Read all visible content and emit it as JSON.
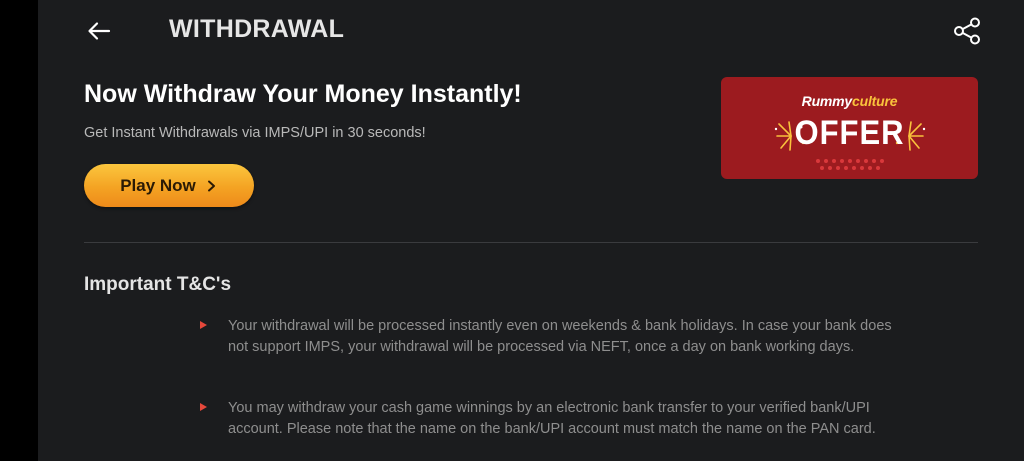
{
  "header": {
    "title": "WITHDRAWAL",
    "back_icon": "arrow-left-icon",
    "share_icon": "share-icon"
  },
  "promo": {
    "title": "Now Withdraw Your Money Instantly!",
    "subtitle": "Get Instant Withdrawals via IMPS/UPI in 30 seconds!",
    "button_label": "Play Now",
    "button_icon": "chevron-right-icon"
  },
  "offer_banner": {
    "brand_part1": "Rummy",
    "brand_part2": "culture",
    "offer_text": "OFFER",
    "background_color": "#9c1b1f",
    "accent_color": "#f9c23c"
  },
  "terms": {
    "heading": "Important T&C's",
    "items": [
      "Your withdrawal will be processed instantly even on weekends & bank holidays. In case your bank does not support IMPS, your withdrawal will be processed via NEFT, once a day on bank working days.",
      "You may withdraw your cash game winnings by an electronic bank transfer to your verified bank/UPI account. Please note that the name on the bank/UPI account must match the name on the PAN card."
    ],
    "bullet_color": "#e5483b"
  },
  "colors": {
    "background": "#1b1c1e",
    "button_gradient_top": "#fbc63e",
    "button_gradient_bottom": "#ee8a1a"
  }
}
